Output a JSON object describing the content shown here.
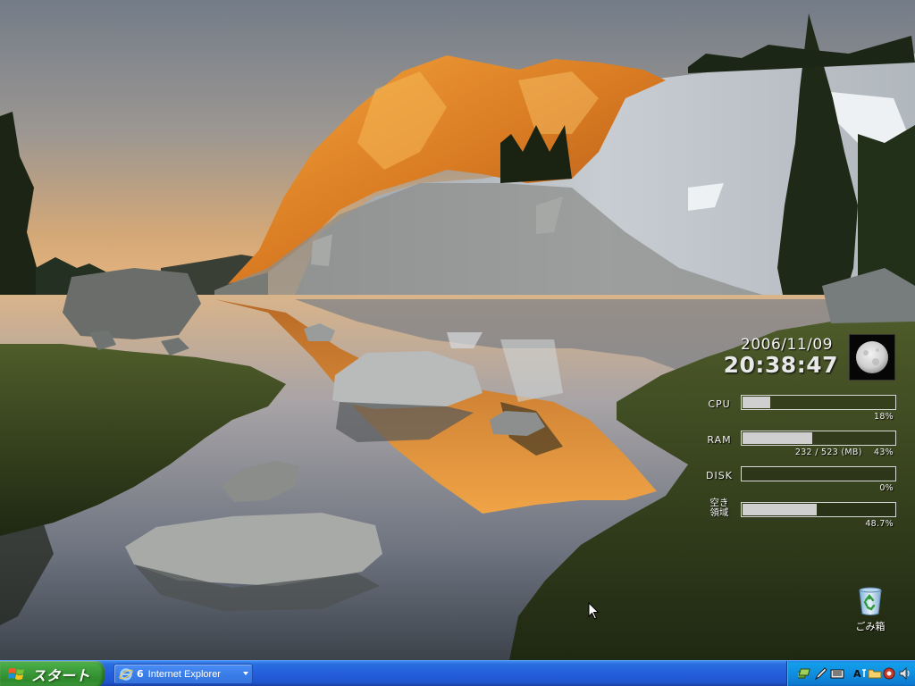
{
  "gadget": {
    "date": "2006/11/09",
    "time": "20:38:47",
    "meters": [
      {
        "label": "CPU",
        "value_text": "18%",
        "fraction": 0.18
      },
      {
        "label": "RAM",
        "value_text": "232 / 523 (MB)    43%",
        "fraction": 0.46
      },
      {
        "label": "DISK",
        "value_text": "0%",
        "fraction": 0.0
      },
      {
        "label_line1": "空き",
        "label_line2": "領域",
        "value_text": "48.7%",
        "fraction": 0.487
      }
    ]
  },
  "desktop_icons": [
    {
      "label": "ごみ箱",
      "icon": "recycle-bin-icon"
    }
  ],
  "taskbar": {
    "start_label": "スタート",
    "group_count": "6",
    "group_label": "Internet Explorer",
    "tray_icons": [
      "network-icon",
      "pen-icon",
      "keyboard-icon",
      "ime-icon",
      "folder-icon",
      "shield-icon",
      "speaker-icon"
    ]
  },
  "colors": {
    "taskbar_blue": "#245edb",
    "start_green": "#3c9b3a",
    "tray_blue": "#0f8ee0",
    "meter_fill": "#cfcfcf"
  }
}
